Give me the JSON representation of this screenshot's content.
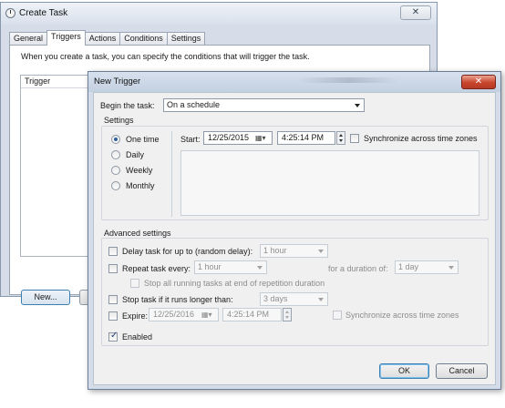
{
  "background_window": {
    "title": "Create Task",
    "close_label": "✕",
    "tabs": [
      "General",
      "Triggers",
      "Actions",
      "Conditions",
      "Settings"
    ],
    "active_tab": "Triggers",
    "description": "When you create a task, you can specify the conditions that will trigger the task.",
    "list_column": "Trigger",
    "new_button": "New..."
  },
  "dialog": {
    "title": "New Trigger",
    "close_label": "✕",
    "begin_label": "Begin the task:",
    "begin_value": "On a schedule",
    "settings_label": "Settings",
    "radios": [
      {
        "label": "One time",
        "checked": true
      },
      {
        "label": "Daily",
        "checked": false
      },
      {
        "label": "Weekly",
        "checked": false
      },
      {
        "label": "Monthly",
        "checked": false
      }
    ],
    "start_label": "Start:",
    "start_date": "12/25/2015",
    "start_time": "4:25:14 PM",
    "sync_label": "Synchronize across time zones",
    "advanced_label": "Advanced settings",
    "delay": {
      "label": "Delay task for up to (random delay):",
      "value": "1 hour"
    },
    "repeat": {
      "label": "Repeat task every:",
      "value": "1 hour",
      "duration_label": "for a duration of:",
      "duration_value": "1 day"
    },
    "stop_running_label": "Stop all running tasks at end of repetition duration",
    "stop_longer": {
      "label": "Stop task if it runs longer than:",
      "value": "3 days"
    },
    "expire": {
      "label": "Expire:",
      "date": "12/25/2016",
      "time": "4:25:14 PM",
      "sync_label": "Synchronize across time zones"
    },
    "enabled_label": "Enabled",
    "ok_label": "OK",
    "cancel_label": "Cancel"
  }
}
